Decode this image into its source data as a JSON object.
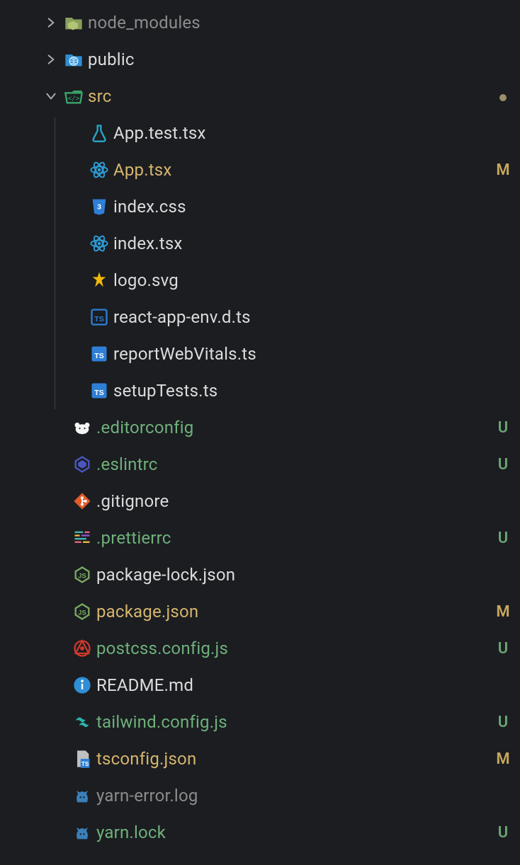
{
  "tree": [
    {
      "id": "node_modules",
      "name": "node_modules",
      "type": "folder-closed",
      "icon": "folder-dim",
      "indent": 0,
      "chevron": "right",
      "labelClass": "label-dim",
      "status": ""
    },
    {
      "id": "public",
      "name": "public",
      "type": "folder-closed",
      "icon": "folder-public",
      "indent": 0,
      "chevron": "right",
      "labelClass": "label-default",
      "status": ""
    },
    {
      "id": "src",
      "name": "src",
      "type": "folder-open",
      "icon": "folder-src",
      "indent": 0,
      "chevron": "down",
      "labelClass": "label-folder-open",
      "status": "dot"
    },
    {
      "id": "app-test",
      "name": "App.test.tsx",
      "type": "file",
      "icon": "flask",
      "indent": 2,
      "chevron": "",
      "labelClass": "label-default",
      "status": ""
    },
    {
      "id": "app-tsx",
      "name": "App.tsx",
      "type": "file",
      "icon": "react",
      "indent": 2,
      "chevron": "",
      "labelClass": "label-modified",
      "status": "M"
    },
    {
      "id": "index-css",
      "name": "index.css",
      "type": "file",
      "icon": "css",
      "indent": 2,
      "chevron": "",
      "labelClass": "label-default",
      "status": ""
    },
    {
      "id": "index-tsx",
      "name": "index.tsx",
      "type": "file",
      "icon": "react",
      "indent": 2,
      "chevron": "",
      "labelClass": "label-default",
      "status": ""
    },
    {
      "id": "logo-svg",
      "name": "logo.svg",
      "type": "file",
      "icon": "svg-star",
      "indent": 2,
      "chevron": "",
      "labelClass": "label-default",
      "status": ""
    },
    {
      "id": "react-app-env",
      "name": "react-app-env.d.ts",
      "type": "file",
      "icon": "ts-outline",
      "indent": 2,
      "chevron": "",
      "labelClass": "label-default",
      "status": ""
    },
    {
      "id": "report-web-vitals",
      "name": "reportWebVitals.ts",
      "type": "file",
      "icon": "ts-solid",
      "indent": 2,
      "chevron": "",
      "labelClass": "label-default",
      "status": ""
    },
    {
      "id": "setup-tests",
      "name": "setupTests.ts",
      "type": "file",
      "icon": "ts-solid",
      "indent": 2,
      "chevron": "",
      "labelClass": "label-default",
      "status": ""
    },
    {
      "id": "editorconfig",
      "name": ".editorconfig",
      "type": "file",
      "icon": "editorconfig",
      "indent": 1,
      "chevron": "",
      "labelClass": "label-untracked",
      "status": "U"
    },
    {
      "id": "eslintrc",
      "name": ".eslintrc",
      "type": "file",
      "icon": "eslint",
      "indent": 1,
      "chevron": "",
      "labelClass": "label-untracked",
      "status": "U"
    },
    {
      "id": "gitignore",
      "name": ".gitignore",
      "type": "file",
      "icon": "git",
      "indent": 1,
      "chevron": "",
      "labelClass": "label-default",
      "status": ""
    },
    {
      "id": "prettierrc",
      "name": ".prettierrc",
      "type": "file",
      "icon": "prettier",
      "indent": 1,
      "chevron": "",
      "labelClass": "label-untracked",
      "status": "U"
    },
    {
      "id": "package-lock",
      "name": "package-lock.json",
      "type": "file",
      "icon": "nodejs",
      "indent": 1,
      "chevron": "",
      "labelClass": "label-default",
      "status": ""
    },
    {
      "id": "package-json",
      "name": "package.json",
      "type": "file",
      "icon": "nodejs",
      "indent": 1,
      "chevron": "",
      "labelClass": "label-modified",
      "status": "M"
    },
    {
      "id": "postcss",
      "name": "postcss.config.js",
      "type": "file",
      "icon": "postcss",
      "indent": 1,
      "chevron": "",
      "labelClass": "label-untracked",
      "status": "U"
    },
    {
      "id": "readme",
      "name": "README.md",
      "type": "file",
      "icon": "info",
      "indent": 1,
      "chevron": "",
      "labelClass": "label-default",
      "status": ""
    },
    {
      "id": "tailwind",
      "name": "tailwind.config.js",
      "type": "file",
      "icon": "tailwind",
      "indent": 1,
      "chevron": "",
      "labelClass": "label-untracked",
      "status": "U"
    },
    {
      "id": "tsconfig",
      "name": "tsconfig.json",
      "type": "file",
      "icon": "tsconfig",
      "indent": 1,
      "chevron": "",
      "labelClass": "label-modified",
      "status": "M"
    },
    {
      "id": "yarn-error",
      "name": "yarn-error.log",
      "type": "file",
      "icon": "yarn",
      "indent": 1,
      "chevron": "",
      "labelClass": "label-dim",
      "status": ""
    },
    {
      "id": "yarn-lock",
      "name": "yarn.lock",
      "type": "file",
      "icon": "yarn",
      "indent": 1,
      "chevron": "",
      "labelClass": "label-untracked",
      "status": "U"
    }
  ]
}
